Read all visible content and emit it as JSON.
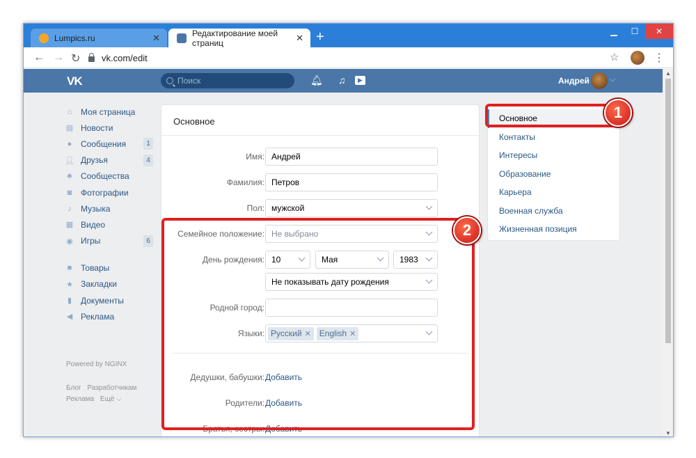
{
  "browser": {
    "tabs": [
      {
        "title": "Lumpics.ru",
        "active": false
      },
      {
        "title": "Редактирование моей страниц",
        "active": true
      }
    ],
    "url": "vk.com/edit"
  },
  "vk_header": {
    "logo": "VK",
    "search_placeholder": "Поиск",
    "user_name": "Андрей"
  },
  "left_nav": {
    "items": [
      {
        "label": "Моя страница",
        "icon": "home-icon",
        "badge": ""
      },
      {
        "label": "Новости",
        "icon": "news-icon",
        "badge": ""
      },
      {
        "label": "Сообщения",
        "icon": "message-icon",
        "badge": "1"
      },
      {
        "label": "Друзья",
        "icon": "friends-icon",
        "badge": "4"
      },
      {
        "label": "Сообщества",
        "icon": "groups-icon",
        "badge": ""
      },
      {
        "label": "Фотографии",
        "icon": "camera-icon",
        "badge": ""
      },
      {
        "label": "Музыка",
        "icon": "music-icon",
        "badge": ""
      },
      {
        "label": "Видео",
        "icon": "video-icon",
        "badge": ""
      },
      {
        "label": "Игры",
        "icon": "gamepad-icon",
        "badge": "6"
      }
    ],
    "items2": [
      {
        "label": "Товары",
        "icon": "bag-icon"
      },
      {
        "label": "Закладки",
        "icon": "star-icon"
      },
      {
        "label": "Документы",
        "icon": "document-icon"
      },
      {
        "label": "Реклама",
        "icon": "megaphone-icon"
      }
    ],
    "powered": "Powered by NGINX",
    "footer": {
      "blog": "Блог",
      "developers": "Разработчикам",
      "ads": "Реклама",
      "more": "Ещё ⌵"
    }
  },
  "form": {
    "title": "Основное",
    "name_label": "Имя:",
    "name_value": "Андрей",
    "surname_label": "Фамилия:",
    "surname_value": "Петров",
    "gender_label": "Пол:",
    "gender_value": "мужской",
    "marital_label": "Семейное положение:",
    "marital_value": "Не выбрано",
    "birthday_label": "День рождения:",
    "bday_day": "10",
    "bday_month": "Мая",
    "bday_year": "1983",
    "bday_visibility": "Не показывать дату рождения",
    "hometown_label": "Родной город:",
    "hometown_value": "",
    "languages_label": "Языки:",
    "languages": [
      "Русский",
      "English"
    ],
    "grandparents_label": "Дедушки, бабушки:",
    "parents_label": "Родители:",
    "siblings_label": "Братья, сестры:",
    "add_link": "Добавить"
  },
  "right_nav": {
    "items": [
      "Основное",
      "Контакты",
      "Интересы",
      "Образование",
      "Карьера",
      "Военная служба",
      "Жизненная позиция"
    ]
  },
  "annotations": {
    "badge1": "1",
    "badge2": "2",
    "color": "#e02020"
  }
}
